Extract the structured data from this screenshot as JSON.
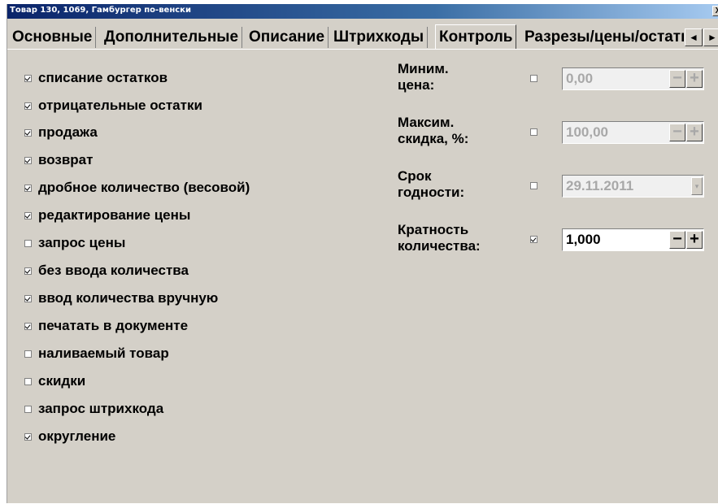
{
  "window": {
    "title": "Товар 130, 1069, Гамбургер по-венски",
    "close_glyph": "X"
  },
  "tabs": [
    {
      "label": "Основные",
      "active": false
    },
    {
      "label": "Дополнительные",
      "active": false
    },
    {
      "label": "Описание",
      "active": false
    },
    {
      "label": "Штрихкоды",
      "active": false
    },
    {
      "label": "Контроль",
      "active": true
    },
    {
      "label": "Разрезы/цены/остатки",
      "active": false
    }
  ],
  "tab_scroll": {
    "left_glyph": "◄",
    "right_glyph": "►"
  },
  "checkboxes": [
    {
      "label": "списание остатков",
      "checked": true
    },
    {
      "label": "отрицательные остатки",
      "checked": true
    },
    {
      "label": "продажа",
      "checked": true
    },
    {
      "label": "возврат",
      "checked": true
    },
    {
      "label": "дробное количество (весовой)",
      "checked": true
    },
    {
      "label": "редактирование цены",
      "checked": true
    },
    {
      "label": "запрос цены",
      "checked": false
    },
    {
      "label": "без ввода количества",
      "checked": true
    },
    {
      "label": "ввод количества вручную",
      "checked": true
    },
    {
      "label": "печатать в документе",
      "checked": true
    },
    {
      "label": "наливаемый товар",
      "checked": false
    },
    {
      "label": "скидки",
      "checked": false
    },
    {
      "label": "запрос штрихкода",
      "checked": false
    },
    {
      "label": "округление",
      "checked": true
    }
  ],
  "controls": [
    {
      "label_line1": "Миним.",
      "label_line2": "цена:",
      "checked": false,
      "value": "0,00",
      "type": "stepper",
      "enabled": false
    },
    {
      "label_line1": "Максим.",
      "label_line2": "скидка, %:",
      "checked": false,
      "value": "100,00",
      "type": "stepper",
      "enabled": false
    },
    {
      "label_line1": "Срок",
      "label_line2": "годности:",
      "checked": false,
      "value": "29.11.2011",
      "type": "date",
      "enabled": false
    },
    {
      "label_line1": "Кратность",
      "label_line2": "количества:",
      "checked": true,
      "value": "1,000",
      "type": "stepper",
      "enabled": true
    }
  ],
  "stepper": {
    "minus": "−",
    "plus": "+"
  },
  "dropdown_glyph": "▾"
}
